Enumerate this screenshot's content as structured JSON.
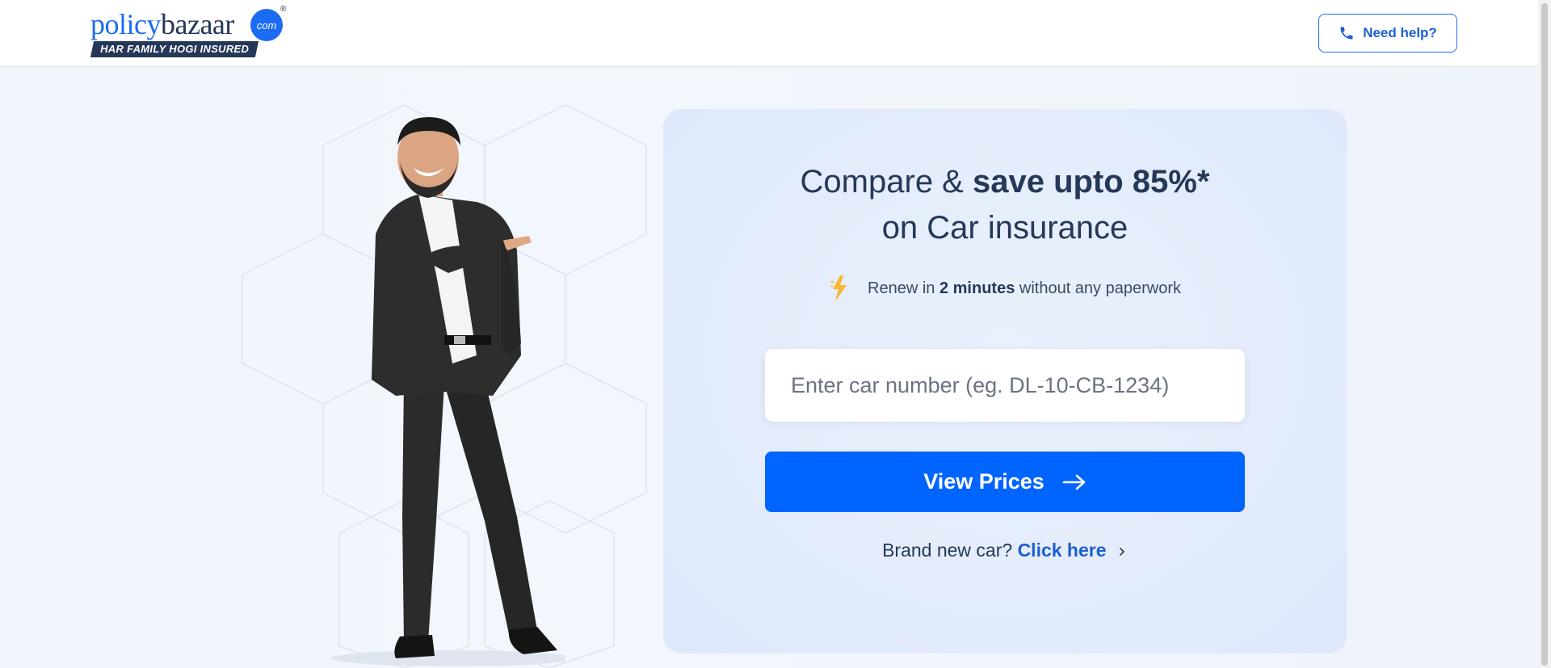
{
  "header": {
    "logo": {
      "word_part1": "policy",
      "word_part2": "bazaar",
      "dot_text": "com",
      "reg_mark": "®",
      "tagline": "HAR FAMILY HOGI INSURED"
    },
    "help_button": {
      "label": "Need help?",
      "icon": "phone-icon"
    }
  },
  "hero": {
    "headline": {
      "prefix": "Compare & ",
      "bold": "save upto 85%*",
      "line2": "on Car insurance"
    },
    "renew": {
      "icon": "lightning-icon",
      "prefix": "Renew in",
      "bold": "2 minutes",
      "suffix": "without any paperwork"
    },
    "car_input": {
      "placeholder": "Enter car number (eg. DL-10-CB-1234)",
      "value": ""
    },
    "view_prices_button": {
      "label": "View Prices",
      "icon": "arrow-right-icon"
    },
    "brand_new": {
      "text": "Brand new car?",
      "link": "Click here",
      "icon": "chevron-right-icon"
    }
  },
  "colors": {
    "brand_blue": "#0065ff",
    "navy": "#253858",
    "link_blue": "#1b5fd1",
    "card_bg": "#e4ecfb",
    "page_bg": "#eef3fb"
  }
}
